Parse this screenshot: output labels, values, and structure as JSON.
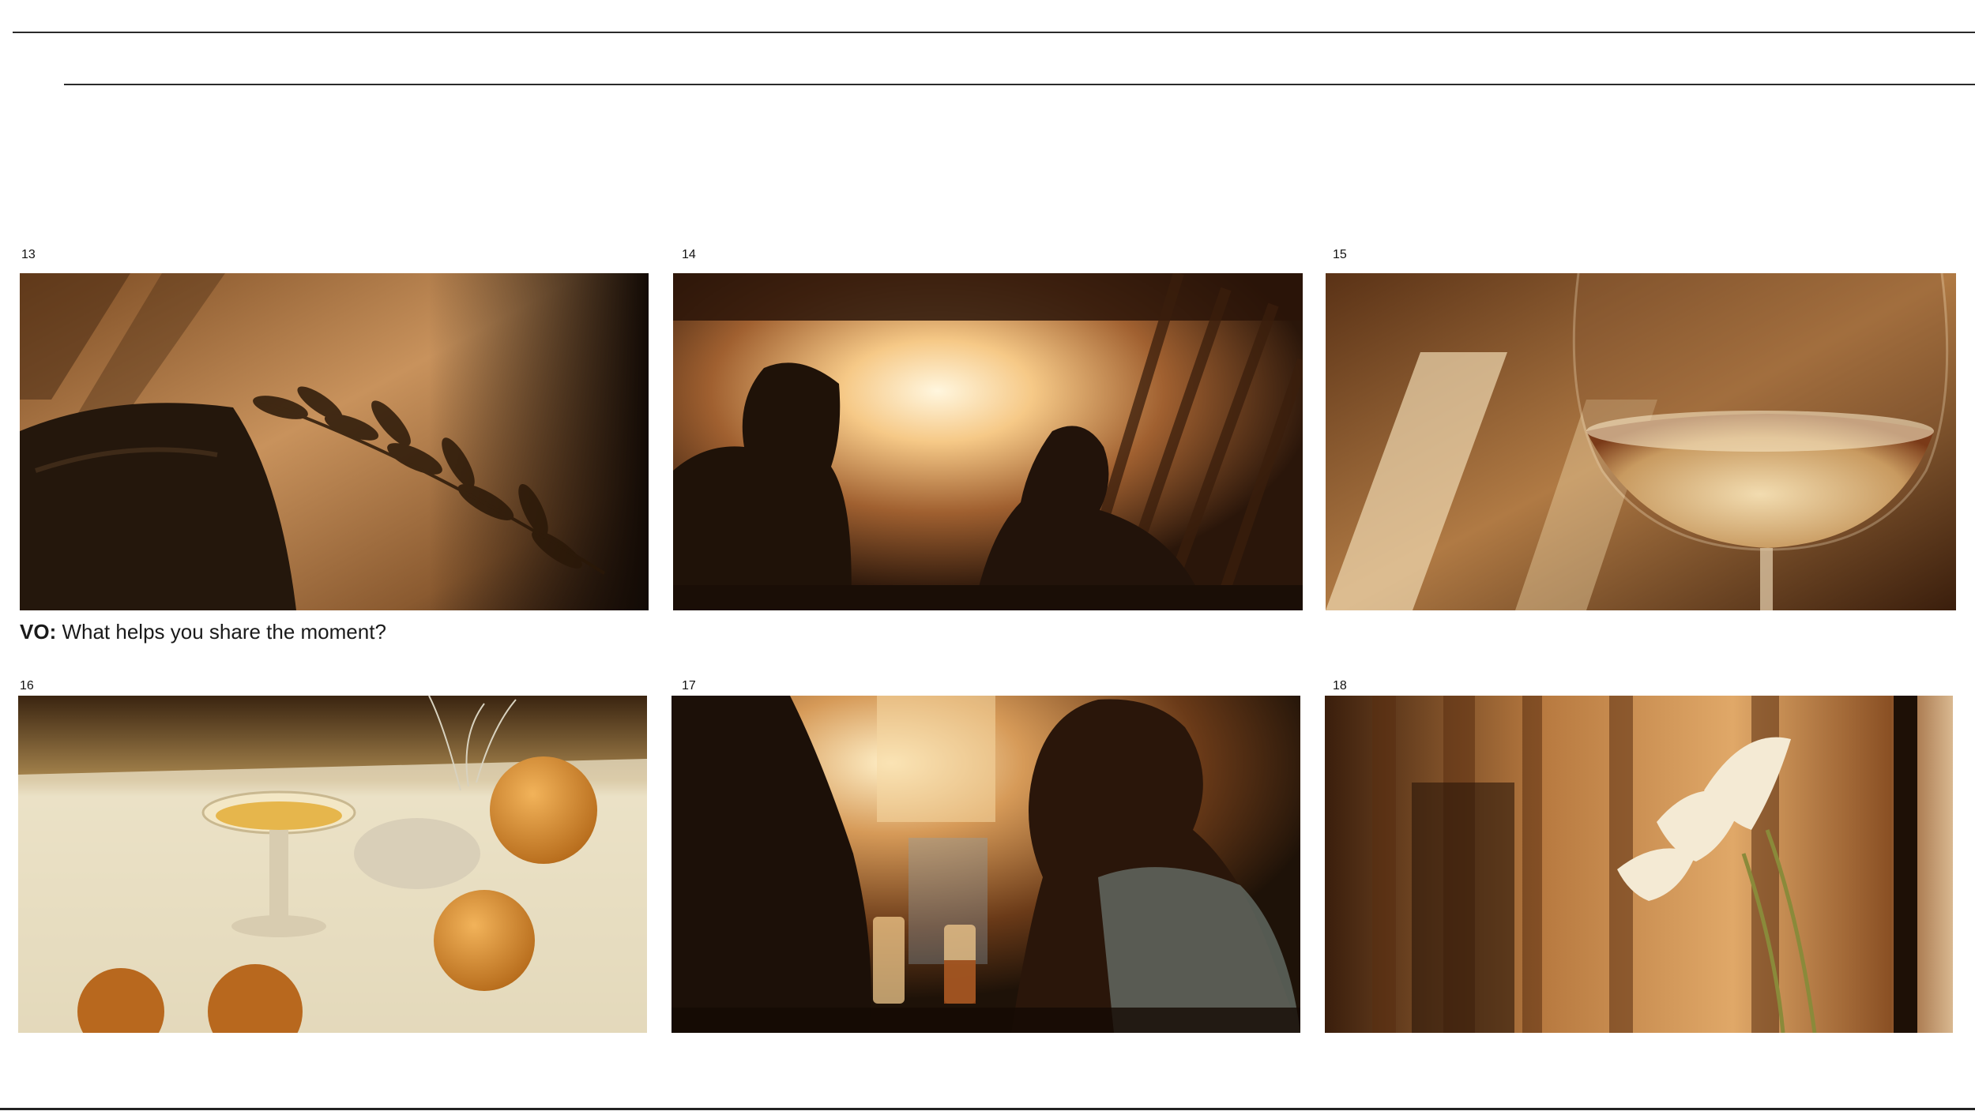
{
  "storyboard": {
    "frames": [
      {
        "number": "13",
        "scene": "leaf-shadow-on-wall"
      },
      {
        "number": "14",
        "scene": "two-silhouettes-backlit"
      },
      {
        "number": "15",
        "scene": "wine-glass-closeup"
      },
      {
        "number": "16",
        "scene": "dessert-glass-and-oranges"
      },
      {
        "number": "17",
        "scene": "woman-profile-at-table"
      },
      {
        "number": "18",
        "scene": "calla-lily-by-curtain"
      }
    ],
    "voiceover": {
      "label": "VO:",
      "text": "What helps you share the moment?"
    }
  },
  "colors": {
    "rule": "#2a2a2a",
    "warm_light": "#f4c98a",
    "deep_shadow": "#1e1208"
  }
}
